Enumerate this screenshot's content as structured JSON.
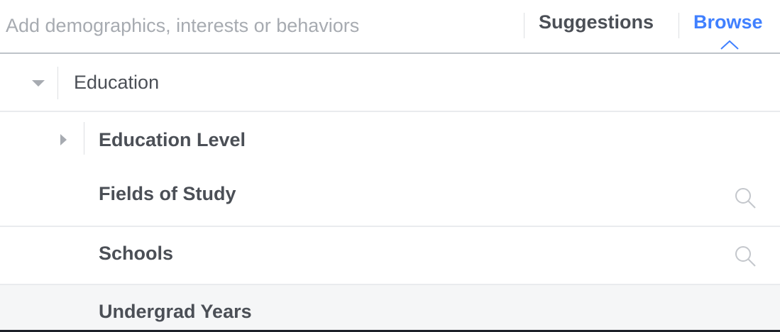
{
  "search": {
    "placeholder": "Add demographics, interests or behaviors",
    "value": ""
  },
  "tabs": {
    "suggestions": "Suggestions",
    "browse": "Browse",
    "active": "browse"
  },
  "tree": {
    "category": {
      "label": "Education",
      "expanded": true
    },
    "items": [
      {
        "label": "Education Level",
        "expandable": true,
        "expanded": false,
        "searchable": false
      },
      {
        "label": "Fields of Study",
        "expandable": false,
        "searchable": true,
        "icon": "search-icon"
      },
      {
        "label": "Schools",
        "expandable": false,
        "searchable": true,
        "icon": "search-icon"
      },
      {
        "label": "Undergrad Years",
        "expandable": false,
        "searchable": false,
        "hovered": true
      }
    ]
  },
  "colors": {
    "text": "#4b4f56",
    "placeholder": "#a7abb1",
    "accent": "#4080ff",
    "divider": "#e9ebee",
    "hover_row": "#f5f6f7"
  }
}
